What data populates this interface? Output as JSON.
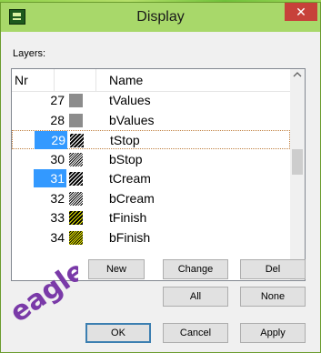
{
  "window": {
    "title": "Display",
    "close_glyph": "✕"
  },
  "layers_label": "Layers:",
  "columns": {
    "nr": "Nr",
    "name": "Name"
  },
  "rows": [
    {
      "nr": "27",
      "name": "tValues",
      "swatch": "gray"
    },
    {
      "nr": "28",
      "name": "bValues",
      "swatch": "gray"
    },
    {
      "nr": "29",
      "name": "tStop",
      "swatch": "hatch",
      "selected": true,
      "focused": true
    },
    {
      "nr": "30",
      "name": "bStop",
      "swatch": "hatch2"
    },
    {
      "nr": "31",
      "name": "tCream",
      "swatch": "hatch",
      "selected": true
    },
    {
      "nr": "32",
      "name": "bCream",
      "swatch": "hatch2"
    },
    {
      "nr": "33",
      "name": "tFinish",
      "swatch": "yel"
    },
    {
      "nr": "34",
      "name": "bFinish",
      "swatch": "yel2"
    }
  ],
  "buttons": {
    "new": "New",
    "change": "Change",
    "del": "Del",
    "all": "All",
    "none": "None",
    "ok": "OK",
    "cancel": "Cancel",
    "apply": "Apply"
  },
  "logo_text": "eagle",
  "colors": {
    "selection": "#3399ff",
    "close": "#c7413a",
    "titlebar": "#a8d86a",
    "logo": "#7a3aa8"
  },
  "icons": {
    "scroll_up": "chevron-up-icon",
    "scroll_down": "chevron-down-icon",
    "close": "close-icon",
    "app": "eagle-app-icon"
  }
}
